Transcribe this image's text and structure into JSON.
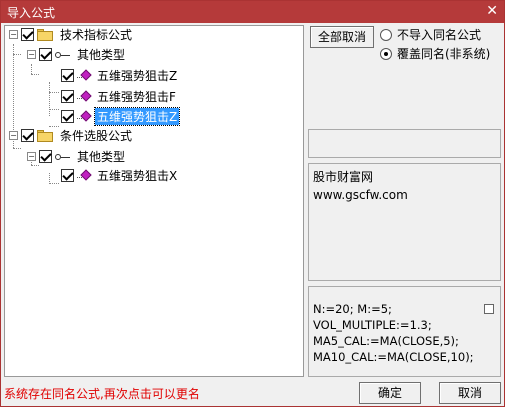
{
  "window": {
    "title": "导入公式",
    "close_glyph": "✕"
  },
  "tree": [
    {
      "label": "技术指标公式",
      "expander": "−",
      "checked": true,
      "icon": "folder-icon"
    },
    {
      "label": "其他类型",
      "expander": "−",
      "checked": true,
      "icon": "key-icon"
    },
    {
      "label": "五维强势狙击Z",
      "checked": true,
      "icon": "formula-icon"
    },
    {
      "label": "五维强势狙击F",
      "checked": true,
      "icon": "formula-icon"
    },
    {
      "label": "五维强势狙击Z",
      "checked": true,
      "icon": "formula-icon",
      "selected": true
    },
    {
      "label": "条件选股公式",
      "expander": "−",
      "checked": true,
      "icon": "folder-icon"
    },
    {
      "label": "其他类型",
      "expander": "−",
      "checked": true,
      "icon": "key-icon"
    },
    {
      "label": "五维强势狙击X",
      "checked": true,
      "icon": "formula-icon"
    }
  ],
  "controls": {
    "deselect_all": "全部取消",
    "radio_skip": "不导入同名公式",
    "radio_overwrite": "覆盖同名(非系统)",
    "selected_radio": "overwrite"
  },
  "info": {
    "line1": "股市财富网",
    "line2": "www.gscfw.com"
  },
  "code_lines": [
    "N:=20; M:=5;",
    "VOL_MULTIPLE:=1.3;",
    "MA5_CAL:=MA(CLOSE,5);",
    "MA10_CAL:=MA(CLOSE,10);"
  ],
  "status": "系统存在同名公式,再次点击可以更名",
  "footer": {
    "ok": "确定",
    "cancel": "取消"
  }
}
